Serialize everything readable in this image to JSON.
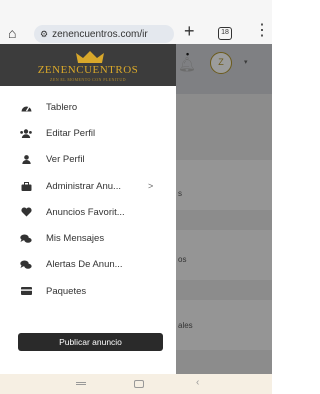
{
  "browser": {
    "url": "zenencuentros.com/ir",
    "tab_count": "18"
  },
  "brand": {
    "name": "ZENENCUENTROS",
    "tagline": "ZEN EL MOMENTO CON PLENITUD"
  },
  "background": {
    "logo_text": "Z",
    "fragments": [
      "s",
      "os",
      "ales"
    ]
  },
  "menu": {
    "items": [
      {
        "label": "Tablero",
        "icon": "dashboard-icon"
      },
      {
        "label": "Editar Perfil",
        "icon": "users-icon"
      },
      {
        "label": "Ver Perfil",
        "icon": "user-icon"
      },
      {
        "label": "Administrar Anu...",
        "icon": "briefcase-icon",
        "chevron": ">"
      },
      {
        "label": "Anuncios Favorit...",
        "icon": "heart-icon"
      },
      {
        "label": "Mis Mensajes",
        "icon": "chat-icon"
      },
      {
        "label": "Alertas De Anun...",
        "icon": "chat-icon"
      },
      {
        "label": "Paquetes",
        "icon": "card-icon"
      }
    ]
  },
  "publish_button": {
    "label": "Publicar anuncio"
  },
  "colors": {
    "brand_bg": "#3c3c3c",
    "brand_gold": "#d9a82a",
    "button_bg": "#2a2a2a",
    "overlay": "#8c8c8c"
  }
}
